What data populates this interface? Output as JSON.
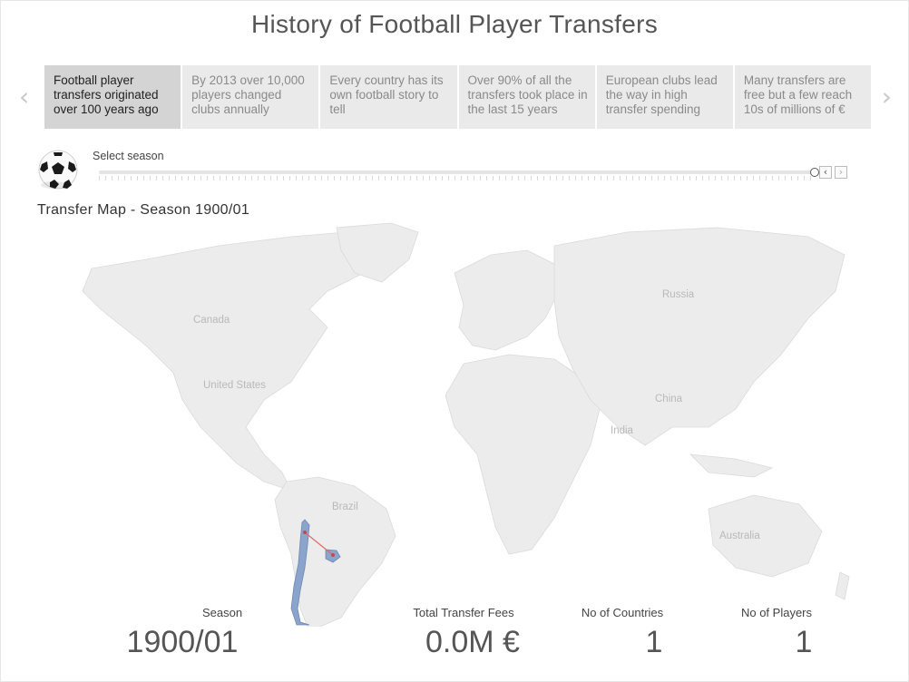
{
  "title": "History of Football Player Transfers",
  "stories": [
    {
      "text": "Football player transfers originated over 100 years ago",
      "active": true
    },
    {
      "text": "By 2013 over 10,000 players changed clubs annually",
      "active": false
    },
    {
      "text": "Every country has its own football story to tell",
      "active": false
    },
    {
      "text": "Over 90% of all the transfers took place in the last 15 years",
      "active": false
    },
    {
      "text": "European clubs lead the way in high transfer spending",
      "active": false
    },
    {
      "text": "Many transfers are free but a few reach 10s of millions of €",
      "active": false
    }
  ],
  "controls": {
    "select_label": "Select season",
    "prev_step": "‹",
    "next_step": "›",
    "prev_story": "‹",
    "next_story": "›"
  },
  "map": {
    "title": "Transfer Map - Season 1900/01",
    "countries": [
      "Canada",
      "United States",
      "Russia",
      "China",
      "India",
      "Brazil",
      "Australia"
    ]
  },
  "kpis": {
    "season_label": "Season",
    "season_value": "1900/01",
    "fees_label": "Total Transfer Fees",
    "fees_value": "0.0M €",
    "countries_label": "No of Countries",
    "countries_value": "1",
    "players_label": "No of Players",
    "players_value": "1"
  },
  "colors": {
    "land": "#ececec",
    "highlight_country": "#8aa4cc",
    "transfer_line": "#e06a6a"
  }
}
